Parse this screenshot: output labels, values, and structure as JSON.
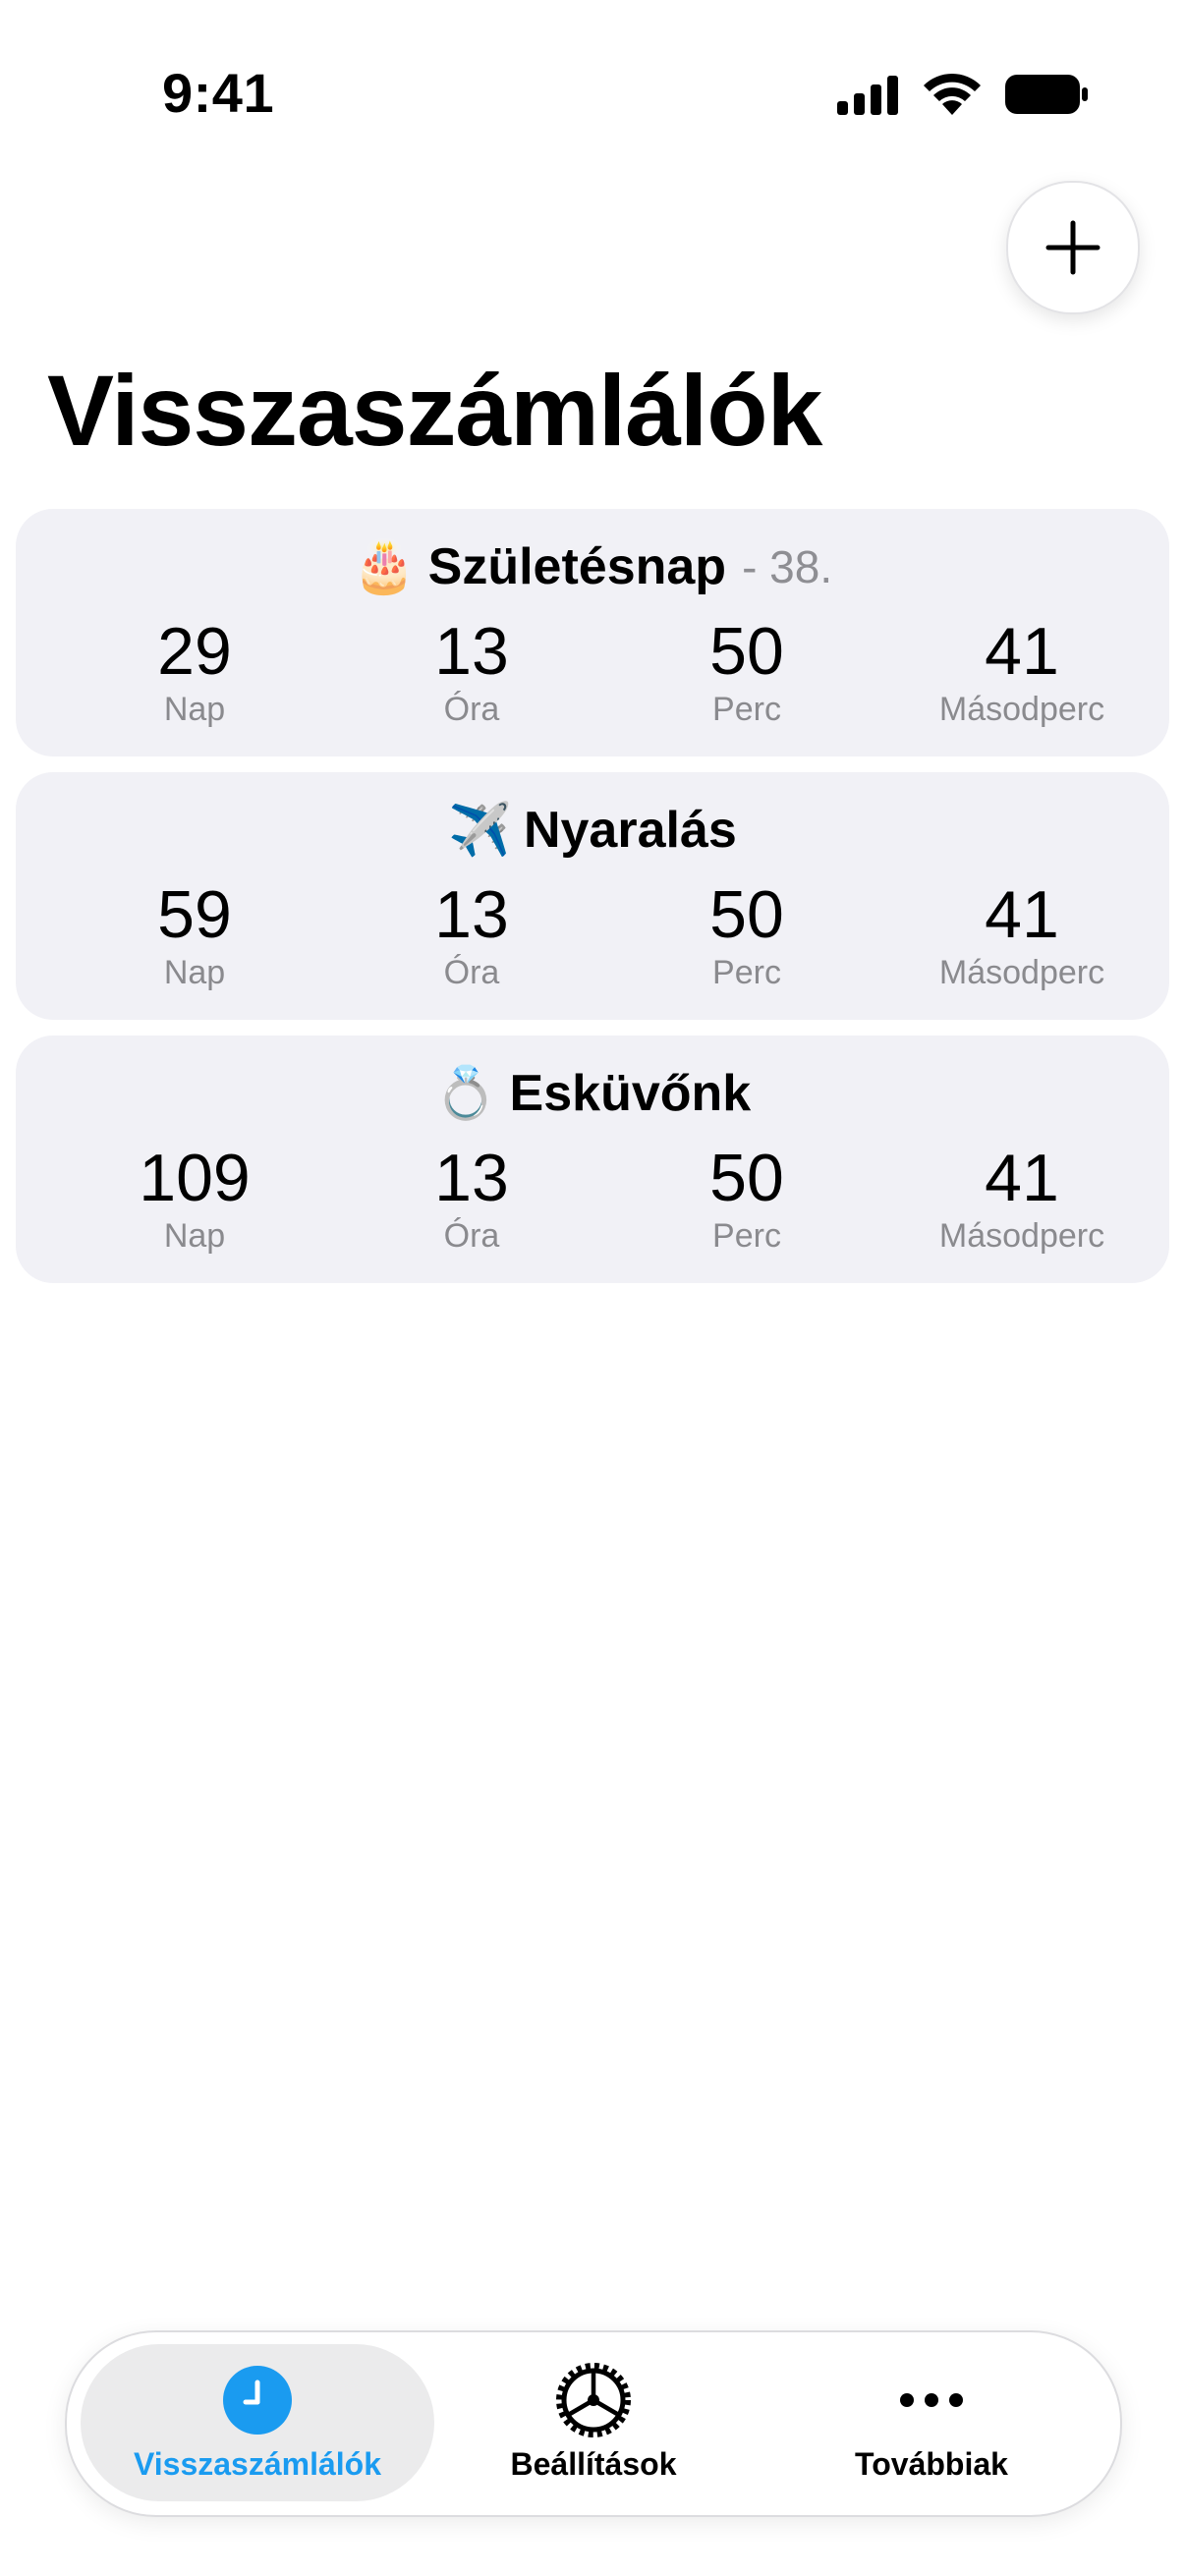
{
  "status_bar": {
    "time": "9:41"
  },
  "header": {
    "title": "Visszaszámlálók",
    "add_icon": "plus-icon"
  },
  "countdowns": [
    {
      "emoji": "🎂",
      "title": "Születésnap",
      "subtitle": "- 38.",
      "units": [
        {
          "value": "29",
          "label": "Nap"
        },
        {
          "value": "13",
          "label": "Óra"
        },
        {
          "value": "50",
          "label": "Perc"
        },
        {
          "value": "41",
          "label": "Másodperc"
        }
      ]
    },
    {
      "emoji": "✈️",
      "title": "Nyaralás",
      "subtitle": "",
      "units": [
        {
          "value": "59",
          "label": "Nap"
        },
        {
          "value": "13",
          "label": "Óra"
        },
        {
          "value": "50",
          "label": "Perc"
        },
        {
          "value": "41",
          "label": "Másodperc"
        }
      ]
    },
    {
      "emoji": "💍",
      "title": "Esküvőnk",
      "subtitle": "",
      "units": [
        {
          "value": "109",
          "label": "Nap"
        },
        {
          "value": "13",
          "label": "Óra"
        },
        {
          "value": "50",
          "label": "Perc"
        },
        {
          "value": "41",
          "label": "Másodperc"
        }
      ]
    }
  ],
  "tab_bar": {
    "tabs": [
      {
        "label": "Visszaszámlálók",
        "icon": "clock-icon",
        "active": true
      },
      {
        "label": "Beállítások",
        "icon": "gear-icon",
        "active": false
      },
      {
        "label": "Továbbiak",
        "icon": "more-icon",
        "active": false
      }
    ]
  },
  "colors": {
    "accent": "#1a9bf0",
    "card_background": "#f1f1f6",
    "secondary_text": "#8e8e93"
  }
}
